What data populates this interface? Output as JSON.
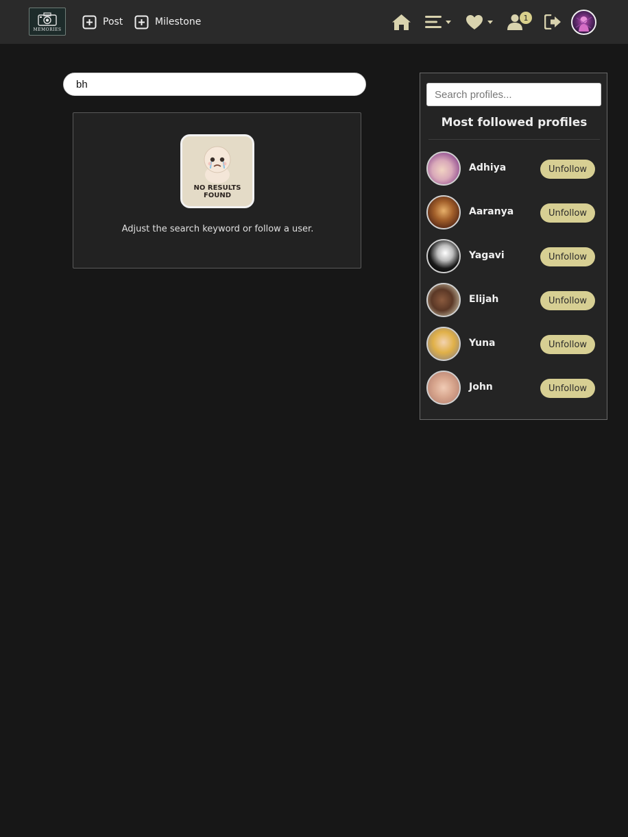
{
  "nav": {
    "logo_text": "MEMORIES",
    "post_label": "Post",
    "milestone_label": "Milestone",
    "notification_count": "1",
    "accent_color": "#d9d3ae",
    "icons": [
      "home-icon",
      "menu-icon",
      "heart-icon",
      "user-icon",
      "logout-icon"
    ]
  },
  "search": {
    "value": "bh"
  },
  "no_results": {
    "image_text_line1": "NO RESULTS",
    "image_text_line2": "FOUND",
    "message": "Adjust the search keyword or follow a user."
  },
  "sidebar": {
    "search_placeholder": "Search profiles...",
    "title": "Most followed profiles",
    "button_color": "#d7cf93",
    "profiles": [
      {
        "name": "Adhiya",
        "button": "Unfollow"
      },
      {
        "name": "Aaranya",
        "button": "Unfollow"
      },
      {
        "name": "Yagavi",
        "button": "Unfollow"
      },
      {
        "name": "Elijah",
        "button": "Unfollow"
      },
      {
        "name": "Yuna",
        "button": "Unfollow"
      },
      {
        "name": "John",
        "button": "Unfollow"
      }
    ]
  }
}
